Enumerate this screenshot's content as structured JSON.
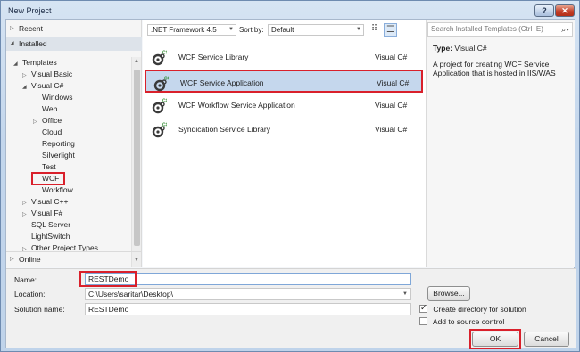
{
  "window": {
    "title": "New Project"
  },
  "left": {
    "recent": "Recent",
    "installed": "Installed",
    "online": "Online",
    "tree": [
      {
        "label": "Templates",
        "level": 0,
        "arrow": "◢"
      },
      {
        "label": "Visual Basic",
        "level": 1,
        "arrow": "▷"
      },
      {
        "label": "Visual C#",
        "level": 1,
        "arrow": "◢"
      },
      {
        "label": "Windows",
        "level": 2,
        "arrow": ""
      },
      {
        "label": "Web",
        "level": 2,
        "arrow": ""
      },
      {
        "label": "Office",
        "level": 2,
        "arrow": "▷"
      },
      {
        "label": "Cloud",
        "level": 2,
        "arrow": ""
      },
      {
        "label": "Reporting",
        "level": 2,
        "arrow": ""
      },
      {
        "label": "Silverlight",
        "level": 2,
        "arrow": ""
      },
      {
        "label": "Test",
        "level": 2,
        "arrow": ""
      },
      {
        "label": "WCF",
        "level": 2,
        "arrow": ""
      },
      {
        "label": "Workflow",
        "level": 2,
        "arrow": ""
      },
      {
        "label": "Visual C++",
        "level": 1,
        "arrow": "▷"
      },
      {
        "label": "Visual F#",
        "level": 1,
        "arrow": "▷"
      },
      {
        "label": "SQL Server",
        "level": 1,
        "arrow": ""
      },
      {
        "label": "LightSwitch",
        "level": 1,
        "arrow": ""
      },
      {
        "label": "Other Project Types",
        "level": 1,
        "arrow": "▷"
      }
    ]
  },
  "toolbar": {
    "framework": ".NET Framework 4.5",
    "sort_label": "Sort by:",
    "sort_value": "Default"
  },
  "templates": [
    {
      "name": "WCF Service Library",
      "lang": "Visual C#"
    },
    {
      "name": "WCF Service Application",
      "lang": "Visual C#"
    },
    {
      "name": "WCF Workflow Service Application",
      "lang": "Visual C#"
    },
    {
      "name": "Syndication Service Library",
      "lang": "Visual C#"
    }
  ],
  "details": {
    "search_placeholder": "Search Installed Templates (Ctrl+E)",
    "type_label": "Type:",
    "type_value": "Visual C#",
    "description": "A project for creating WCF Service Application that is hosted in IIS/WAS"
  },
  "form": {
    "name_label": "Name:",
    "name_value": "RESTDemo",
    "location_label": "Location:",
    "location_value": "C:\\Users\\saritar\\Desktop\\",
    "solution_label": "Solution name:",
    "solution_value": "RESTDemo",
    "browse": "Browse...",
    "create_dir": "Create directory for solution",
    "add_source": "Add to source control",
    "ok": "OK",
    "cancel": "Cancel"
  },
  "colors": {
    "highlight": "#d9202b",
    "selection": "#c5d7ed"
  }
}
